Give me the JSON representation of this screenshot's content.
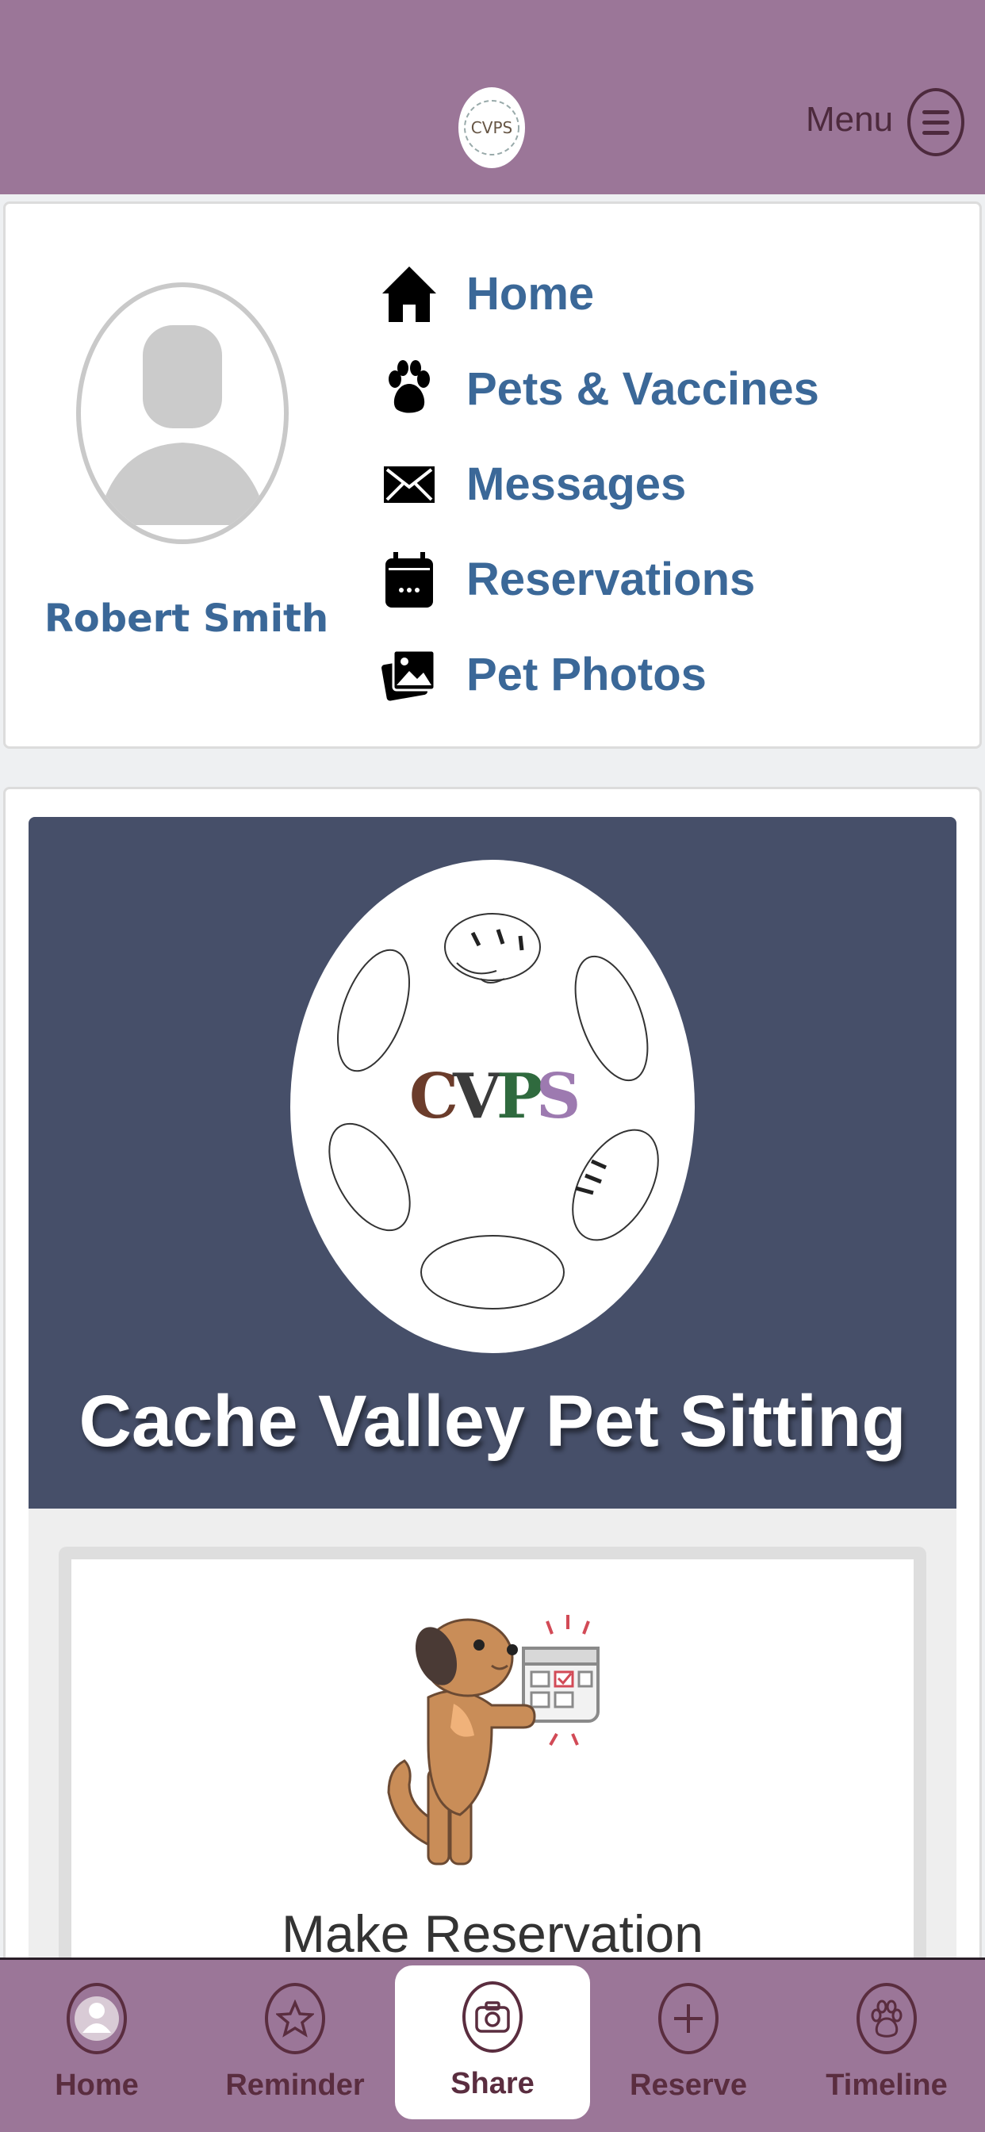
{
  "header": {
    "menu_label": "Menu"
  },
  "profile": {
    "name": "Robert Smith"
  },
  "nav": [
    {
      "label": "Home",
      "icon": "home-icon"
    },
    {
      "label": "Pets & Vaccines",
      "icon": "paw-icon"
    },
    {
      "label": "Messages",
      "icon": "envelope-icon"
    },
    {
      "label": "Reservations",
      "icon": "calendar-icon"
    },
    {
      "label": "Pet Photos",
      "icon": "photos-icon"
    }
  ],
  "hero": {
    "title": "Cache Valley Pet Sitting",
    "logo_text": "CVPS"
  },
  "reservation_card": {
    "title": "Make Reservation"
  },
  "tabs": [
    {
      "label": "Home",
      "icon": "user-icon"
    },
    {
      "label": "Reminder",
      "icon": "star-icon"
    },
    {
      "label": "Share",
      "icon": "camera-icon",
      "active": true
    },
    {
      "label": "Reserve",
      "icon": "plus-icon"
    },
    {
      "label": "Timeline",
      "icon": "paw-icon"
    }
  ],
  "colors": {
    "header_bg": "#9b7698",
    "link_blue": "#3b6898",
    "hero_bg": "#464f69",
    "tab_text": "#5a2d3f"
  }
}
